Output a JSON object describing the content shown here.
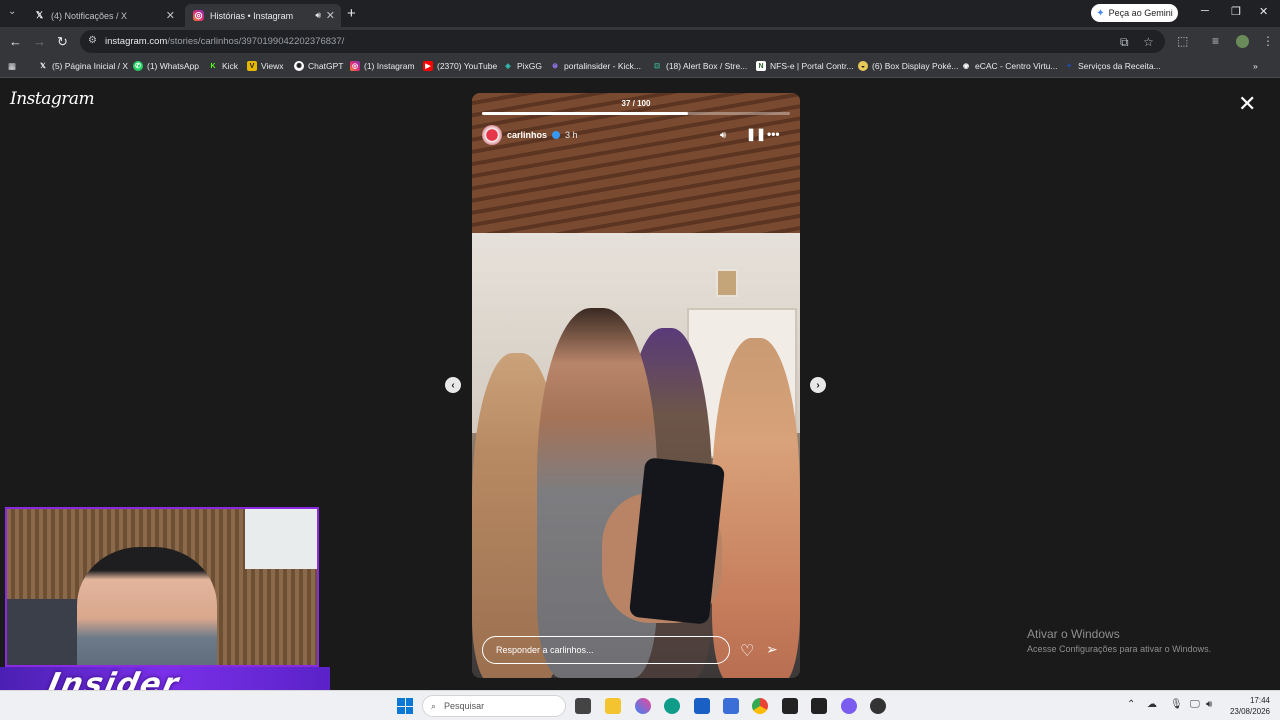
{
  "browser": {
    "tabs": [
      {
        "title": "(4) Notificações / X",
        "icon": "x-logo-icon",
        "active": false
      },
      {
        "title": "Histórias • Instagram",
        "icon": "instagram-icon",
        "active": true
      }
    ],
    "gemini_label": "Peça ao Gemini",
    "url_host": "instagram.com",
    "url_path": "/stories/carlinhos/3970199042202376837/",
    "bookmarks": [
      {
        "label": "(5) Página Inicial / X",
        "icon": "x-logo-icon"
      },
      {
        "label": "(1) WhatsApp",
        "icon": "whatsapp-icon"
      },
      {
        "label": "Kick",
        "icon": "kick-icon"
      },
      {
        "label": "Viewx",
        "icon": "viewx-icon"
      },
      {
        "label": "ChatGPT",
        "icon": "chatgpt-icon"
      },
      {
        "label": "(1) Instagram",
        "icon": "instagram-icon"
      },
      {
        "label": "(2370) YouTube",
        "icon": "youtube-icon"
      },
      {
        "label": "PixGG",
        "icon": "pixgg-icon"
      },
      {
        "label": "portalinsider - Kick...",
        "icon": "portalinsider-icon"
      },
      {
        "label": "(18) Alert Box / Stre...",
        "icon": "alertbox-icon"
      },
      {
        "label": "NFS-e | Portal Contr...",
        "icon": "nfse-icon"
      },
      {
        "label": "(6) Box Display Poké...",
        "icon": "box-display-icon"
      },
      {
        "label": "eCAC - Centro Virtu...",
        "icon": "ecac-icon"
      },
      {
        "label": "Serviços da Receita...",
        "icon": "receita-icon"
      }
    ]
  },
  "instagram": {
    "logo": "Instagram",
    "story": {
      "counter": "37 / 100",
      "progress": 0.67,
      "username": "carlinhos",
      "time": "3 h",
      "reply_placeholder": "Responder a carlinhos..."
    }
  },
  "windows_activation": {
    "title": "Ativar o Windows",
    "subtitle": "Acesse Configurações para ativar o Windows."
  },
  "overlay": {
    "text": "Insider"
  },
  "taskbar": {
    "search_placeholder": "Pesquisar",
    "time": "17:44",
    "date": "23/08/2026"
  }
}
